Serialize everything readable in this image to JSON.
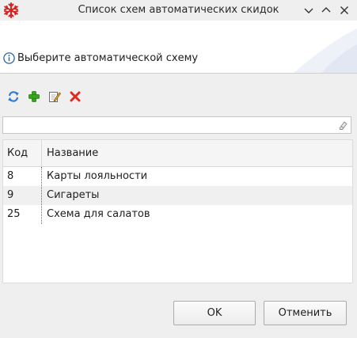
{
  "window": {
    "title": "Список схем автоматических скидок",
    "controls": {
      "minimize_icon": "chevron-down-icon",
      "maximize_icon": "chevron-up-icon",
      "close_icon": "close-icon"
    }
  },
  "info": {
    "icon": "info-icon",
    "text": "Выберите автоматической схему"
  },
  "toolbar": {
    "items": [
      {
        "name": "refresh",
        "icon": "refresh-icon"
      },
      {
        "name": "add",
        "icon": "plus-icon"
      },
      {
        "name": "edit",
        "icon": "edit-icon"
      },
      {
        "name": "delete",
        "icon": "delete-x-icon"
      }
    ]
  },
  "filter": {
    "value": "",
    "placeholder": "",
    "clear_icon": "eraser-icon"
  },
  "table": {
    "columns": [
      "Код",
      "Название"
    ],
    "rows": [
      {
        "code": "8",
        "name": "Карты лояльности"
      },
      {
        "code": "9",
        "name": "Сигареты"
      },
      {
        "code": "25",
        "name": "Схема для салатов"
      }
    ]
  },
  "buttons": {
    "ok": "OK",
    "cancel": "Отменить"
  },
  "colors": {
    "refresh": "#2f7bd3",
    "add": "#37a51a",
    "delete": "#e02a1e",
    "app_icon": "#d82222",
    "info": "#1f66b5"
  }
}
